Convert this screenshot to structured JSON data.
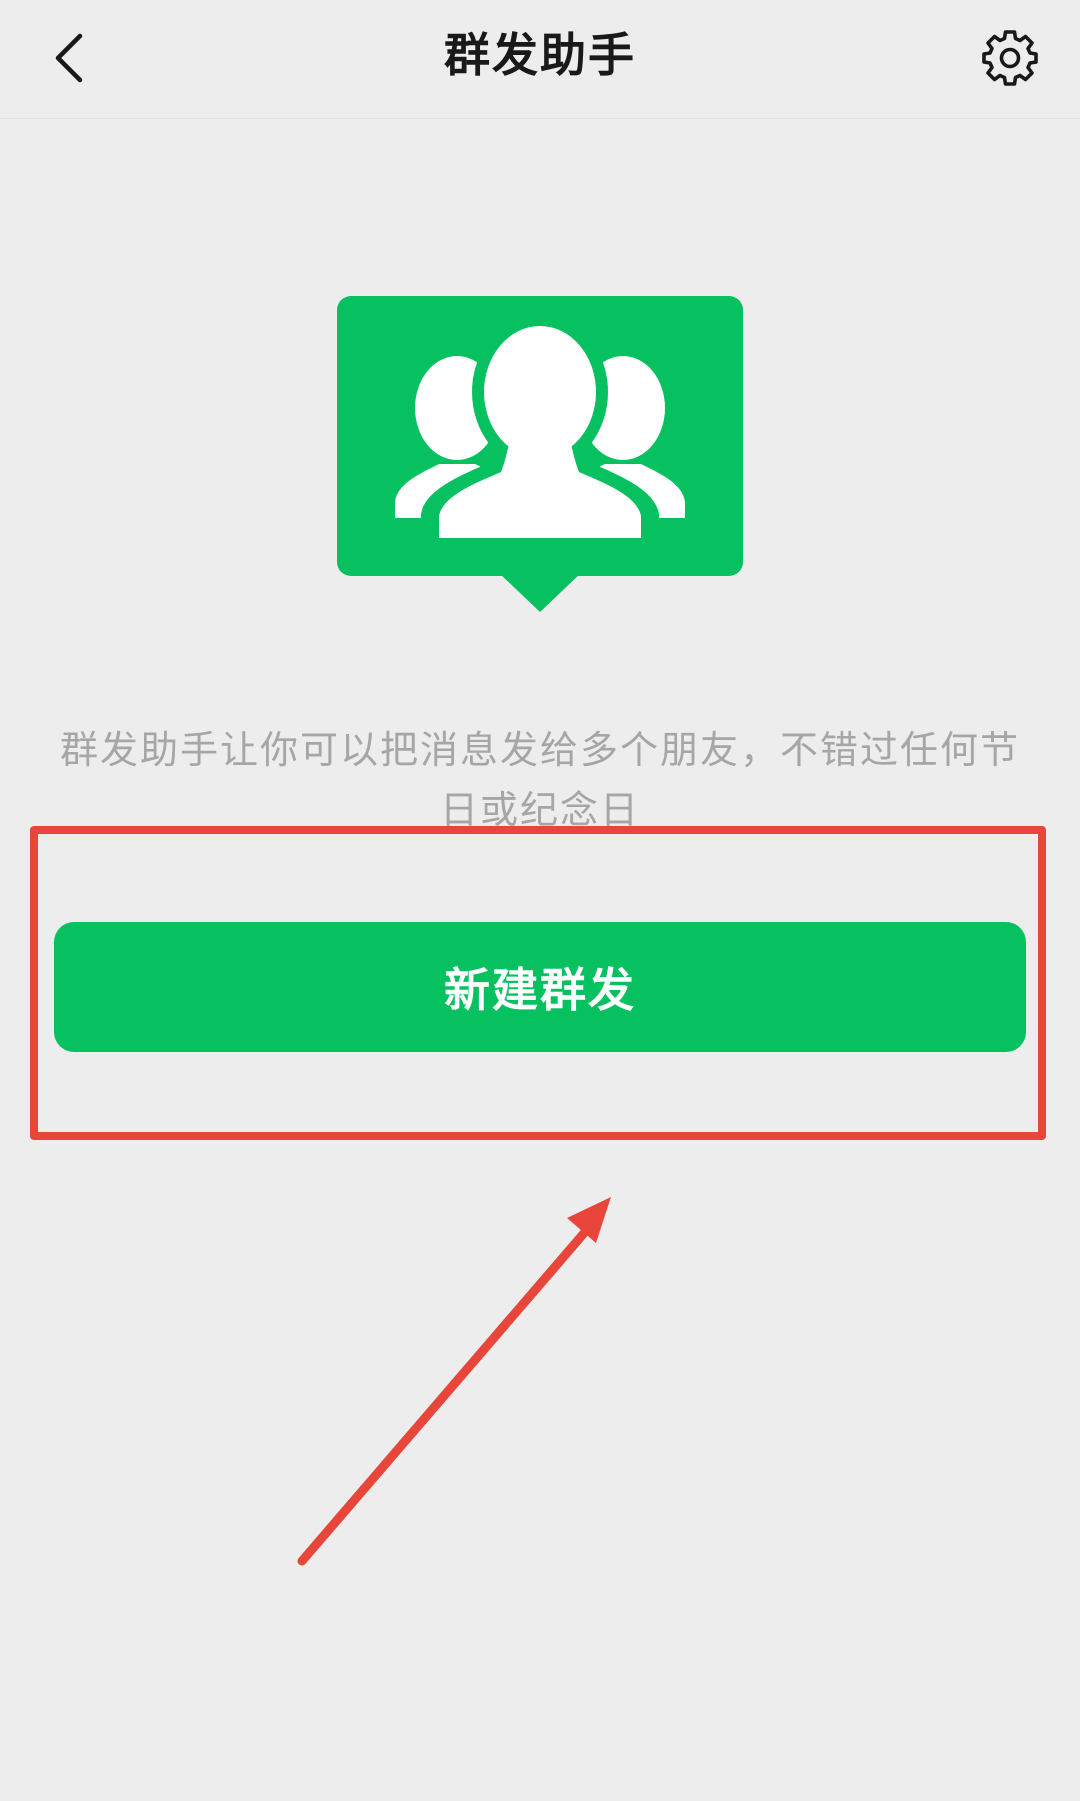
{
  "nav": {
    "title": "群发助手",
    "back_icon": "chevron-left-icon",
    "settings_icon": "gear-icon"
  },
  "hero": {
    "icon": "group-chat-icon"
  },
  "description": "群发助手让你可以把消息发给多个朋友，不错过任何节日或纪念日",
  "primary_action": {
    "label": "新建群发"
  },
  "annotation": {
    "highlight_icon": "red-rectangle-highlight",
    "arrow_icon": "red-arrow-icon"
  },
  "colors": {
    "background": "#ededed",
    "brand_green": "#07c160",
    "annotation_red": "#e9463b",
    "description_gray": "#a6a6a6",
    "title_text": "#191919"
  }
}
